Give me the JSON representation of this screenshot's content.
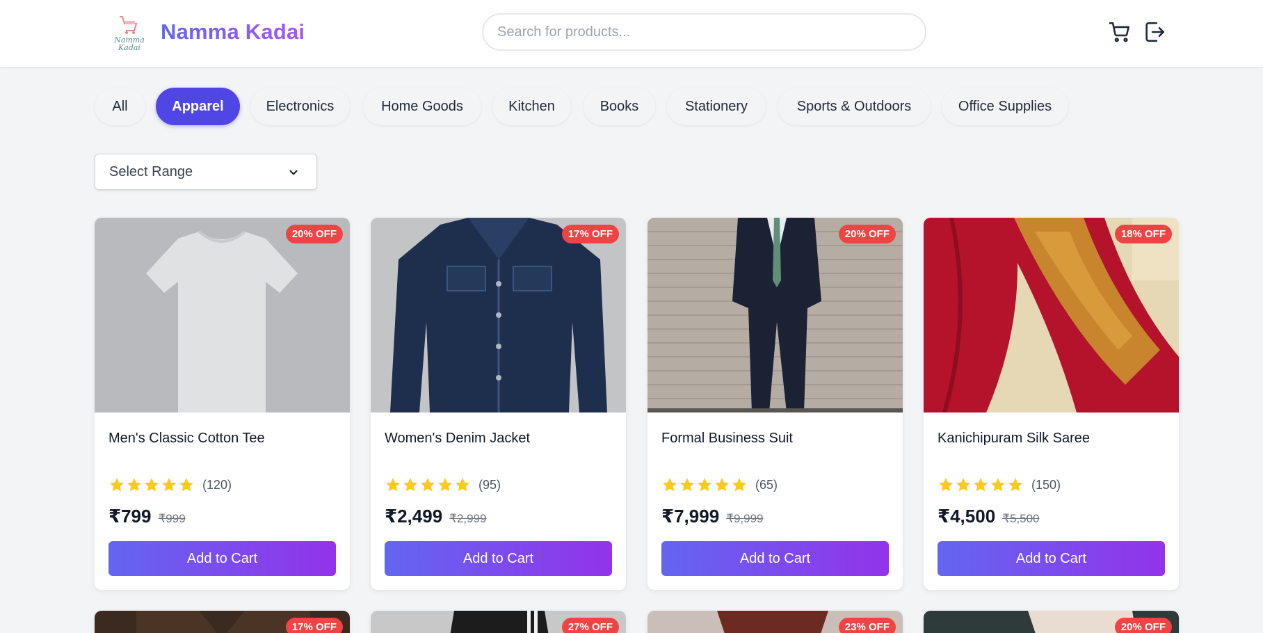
{
  "header": {
    "brand": "Namma Kadai",
    "logo_text": "Namma Kadai",
    "search_placeholder": "Search for products...",
    "search_value": "",
    "icons": [
      "cart-icon",
      "logout-icon"
    ]
  },
  "categories": [
    {
      "label": "All",
      "active": false
    },
    {
      "label": "Apparel",
      "active": true
    },
    {
      "label": "Electronics",
      "active": false
    },
    {
      "label": "Home Goods",
      "active": false
    },
    {
      "label": "Kitchen",
      "active": false
    },
    {
      "label": "Books",
      "active": false
    },
    {
      "label": "Stationery",
      "active": false
    },
    {
      "label": "Sports & Outdoors",
      "active": false
    },
    {
      "label": "Office Supplies",
      "active": false
    }
  ],
  "range_select": {
    "selected": "Select Range"
  },
  "products": [
    {
      "name": "Men's Classic Cotton Tee",
      "badge": "20% OFF",
      "rating_count": "(120)",
      "price": "₹799",
      "original_price": "₹999",
      "button": "Add to Cart",
      "stars": 5
    },
    {
      "name": "Women's Denim Jacket",
      "badge": "17% OFF",
      "rating_count": "(95)",
      "price": "₹2,499",
      "original_price": "₹2,999",
      "button": "Add to Cart",
      "stars": 5
    },
    {
      "name": "Formal Business Suit",
      "badge": "20% OFF",
      "rating_count": "(65)",
      "price": "₹7,999",
      "original_price": "₹9,999",
      "button": "Add to Cart",
      "stars": 5
    },
    {
      "name": "Kanichipuram Silk Saree",
      "badge": "18% OFF",
      "rating_count": "(150)",
      "price": "₹4,500",
      "original_price": "₹5,500",
      "button": "Add to Cart",
      "stars": 5
    }
  ],
  "products_row2": [
    {
      "badge": "17% OFF"
    },
    {
      "badge": "27% OFF"
    },
    {
      "badge": "23% OFF"
    },
    {
      "badge": "20% OFF"
    }
  ],
  "colors": {
    "accent": "#4f46e5",
    "badge": "#ef4444",
    "star": "#facc15",
    "button_gradient_start": "#6366f1",
    "button_gradient_end": "#9333ea"
  }
}
